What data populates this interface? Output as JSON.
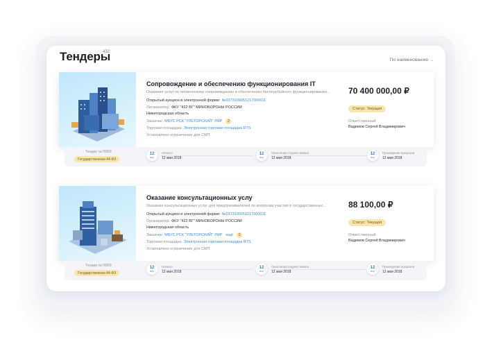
{
  "page": {
    "title": "Тендеры",
    "count": "432",
    "sort_label": "По наименованию",
    "sort_icon": "chevron-down-icon"
  },
  "colors": {
    "accent_link": "#3b8fe0",
    "status_bg": "#f8e6ac",
    "date_accent": "#2f7fd6"
  },
  "tenders": [
    {
      "title": "Сопровождение и обеспечению функционирования IT",
      "description": "Оказание услуг по техническому сопровождению и обеспечению бесперебойного функционирования...",
      "auction_label": "Открытый аукцион в электронной форме:",
      "auction_no": "№0373100051217000011",
      "organizer_label": "Организатор:",
      "organizer": "ФКУ \"422 ВГ\" МИНОБОРОНЫ РОССИИ",
      "region": "Нижегородская область",
      "customer_label": "Заказчик:",
      "customer": "МБУС РСК \"УЛЕТОРСКИЙ\" УМР",
      "customer_more": "",
      "customer_extra": "2",
      "platform_label": "Торговая площадка:",
      "platform": "Электронная торговая площадка RTS",
      "restriction": "Установлено ограничение для СМП",
      "price": "70 400 000,00 ₽",
      "status": "Статус: Текущая",
      "responsible_label": "Ответственный:",
      "responsible": "Вадимов Сергей Владимирович",
      "tender_no": "Тендер №76859",
      "tender_type": "Государственная 44-ФЗ",
      "stages": [
        {
          "day": "12",
          "month": "мар",
          "label": "Начало",
          "date": "12 мая 2018"
        },
        {
          "day": "12",
          "month": "мар",
          "label": "Окончание подачи заявок",
          "date": "12 мая 2018"
        },
        {
          "day": "12",
          "month": "мар",
          "label": "Проведение аукциона",
          "date": "12 мая 2018"
        }
      ]
    },
    {
      "title": "Оказание консультационных услу",
      "description": "Оказание консультационных услуг для предпринимателей по вопросам участия в государственных...",
      "auction_label": "Открытый аукцион в электронной форме:",
      "auction_no": "№0373100051217000011",
      "organizer_label": "Организатор:",
      "organizer": "ФКУ \"422 ВГ\" МИНОБОРОНЫ РОССИИ",
      "region": "Нижегородская область",
      "customer_label": "Заказчик:",
      "customer": "МБУС РСК \"УЛЕТОРСКИЙ\" УМР",
      "customer_more": "ещё",
      "customer_extra": "2",
      "platform_label": "Торговая площадка:",
      "platform": "Электронная торговая площадка RTS",
      "restriction": "Установлено ограничение для СМП",
      "price": "88 100,00 ₽",
      "status": "Статус: Текущая",
      "responsible_label": "Ответственный:",
      "responsible": "Вадимов Сергей Владимирович",
      "tender_no": "Тендер №76859",
      "tender_type": "Государственная 44-ФЗ",
      "stages": [
        {
          "day": "12",
          "month": "мар",
          "label": "Начало",
          "date": "12 мая 2018"
        },
        {
          "day": "12",
          "month": "мар",
          "label": "Окончание подачи заявок",
          "date": "12 мая 2018"
        },
        {
          "day": "12",
          "month": "мар",
          "label": "Проведение аукциона",
          "date": "12 мая 2018"
        }
      ]
    }
  ]
}
